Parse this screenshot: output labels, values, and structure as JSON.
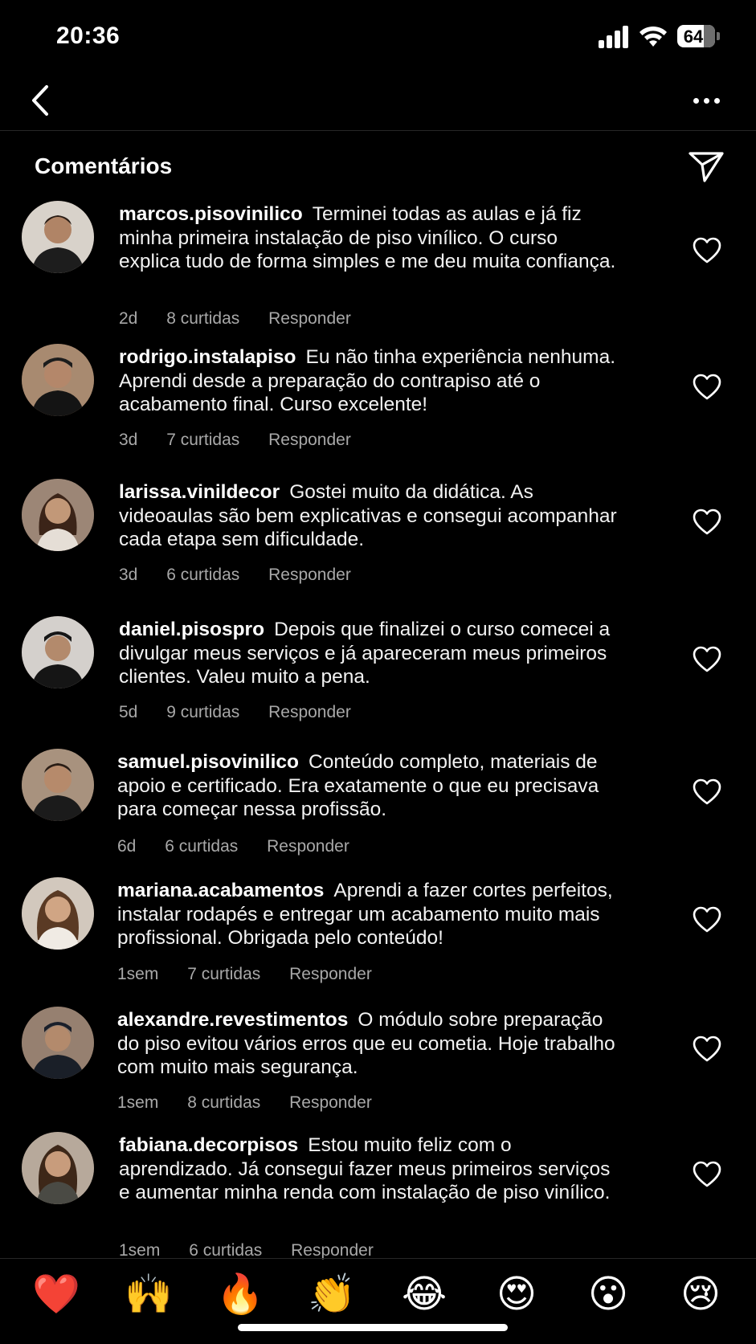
{
  "status_bar": {
    "time": "20:36",
    "battery": "64"
  },
  "header": {
    "title": "Comentários"
  },
  "comments": [
    {
      "user": "marcos.pisovinilico",
      "text": "Terminei todas as aulas e já fiz minha primeira instalação de piso vinílico. O curso explica tudo de forma simples e me deu muita confiança.",
      "time": "2d",
      "likes": "8 curtidas",
      "reply": "Responder",
      "avatar_color": "#6b4a35"
    },
    {
      "user": "rodrigo.instalapiso",
      "text": "Eu não tinha experiência nenhuma. Aprendi desde a preparação do contrapiso até o acabamento final. Curso excelente!",
      "time": "3d",
      "likes": "7 curtidas",
      "reply": "Responder",
      "avatar_color": "#5a4030"
    },
    {
      "user": "larissa.vinildecor",
      "text": "Gostei muito da didática. As videoaulas são bem explicativas e consegui acompanhar cada etapa sem dificuldade.",
      "time": "3d",
      "likes": "6 curtidas",
      "reply": "Responder",
      "avatar_color": "#7a5a45"
    },
    {
      "user": "daniel.pisospro",
      "text": "Depois que finalizei o curso comecei a divulgar meus serviços e já apareceram meus primeiros clientes. Valeu muito a pena.",
      "time": "5d",
      "likes": "9 curtidas",
      "reply": "Responder",
      "avatar_color": "#8a8580"
    },
    {
      "user": "samuel.pisovinilico",
      "text": "Conteúdo completo, materiais de apoio e certificado. Era exatamente o que eu precisava para começar nessa profissão.",
      "time": "6d",
      "likes": "6 curtidas",
      "reply": "Responder",
      "avatar_color": "#6a5545"
    },
    {
      "user": "mariana.acabamentos",
      "text": "Aprendi a fazer cortes perfeitos, instalar rodapés e entregar um acabamento muito mais profissional. Obrigada pelo conteúdo!",
      "time": "1sem",
      "likes": "7 curtidas",
      "reply": "Responder",
      "avatar_color": "#8a6a55"
    },
    {
      "user": "alexandre.revestimentos",
      "text": "O módulo sobre preparação do piso evitou vários erros que eu cometia. Hoje trabalho com muito mais segurança.",
      "time": "1sem",
      "likes": "8 curtidas",
      "reply": "Responder",
      "avatar_color": "#5f5045"
    },
    {
      "user": "fabiana.decorpisos",
      "text": "Estou muito feliz com o aprendizado. Já consegui fazer meus primeiros serviços e aumentar minha renda com instalação de piso vinílico.",
      "time": "1sem",
      "likes": "6 curtidas",
      "reply": "Responder",
      "avatar_color": "#7d6252"
    }
  ],
  "reactions": [
    {
      "emoji": "❤️",
      "name": "red-heart"
    },
    {
      "emoji": "🙌",
      "name": "raising-hands"
    },
    {
      "emoji": "🔥",
      "name": "fire"
    },
    {
      "emoji": "👏",
      "name": "clapping-hands"
    },
    {
      "emoji": "😂",
      "name": "tears-of-joy"
    },
    {
      "emoji": "😍",
      "name": "heart-eyes"
    },
    {
      "emoji": "😮",
      "name": "open-mouth"
    },
    {
      "emoji": "😢",
      "name": "crying-face"
    }
  ]
}
